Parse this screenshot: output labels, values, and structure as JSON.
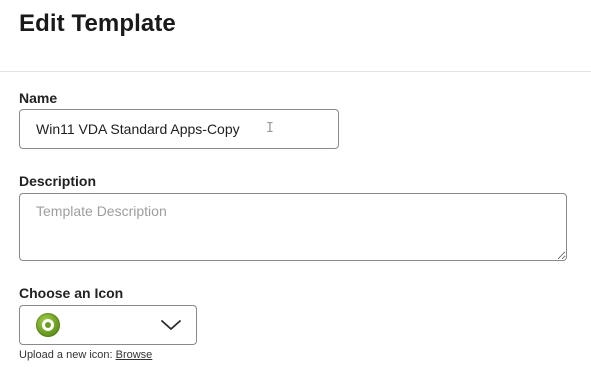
{
  "header": {
    "title": "Edit Template"
  },
  "form": {
    "name": {
      "label": "Name",
      "value": "Win11 VDA Standard Apps-Copy"
    },
    "description": {
      "label": "Description",
      "value": "",
      "placeholder": "Template Description"
    },
    "icon": {
      "label": "Choose an Icon",
      "selected_icon": "green-disc-icon",
      "selected_icon_color": "#6c9e22"
    },
    "upload": {
      "text": "Upload a new icon: ",
      "link_label": "Browse"
    }
  }
}
